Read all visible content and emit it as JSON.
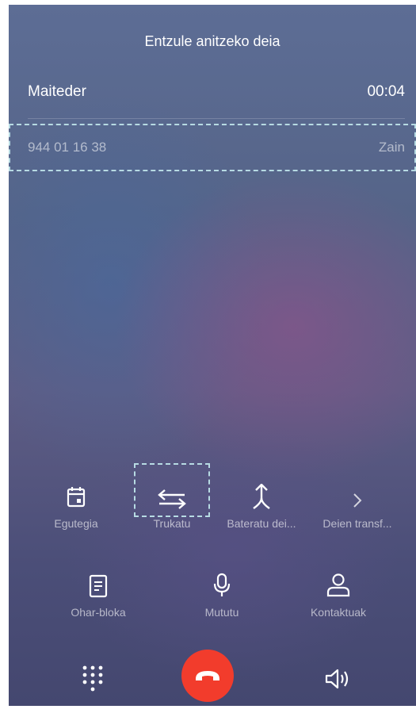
{
  "call": {
    "title": "Entzule anitzeko deia",
    "active": {
      "name": "Maiteder",
      "duration": "00:04"
    },
    "held": {
      "number": "944 01 16 38",
      "status": "Zain"
    }
  },
  "actions": {
    "row1": [
      {
        "label": "Egutegia",
        "icon": "calendar-icon"
      },
      {
        "label": "Trukatu",
        "icon": "swap-icon"
      },
      {
        "label": "Bateratu dei...",
        "icon": "merge-icon"
      },
      {
        "label": "Deien transf...",
        "icon": "chevron-right-icon"
      }
    ],
    "row2": [
      {
        "label": "Ohar-bloka",
        "icon": "notepad-icon"
      },
      {
        "label": "Mututu",
        "icon": "microphone-icon"
      },
      {
        "label": "Kontaktuak",
        "icon": "contact-icon"
      }
    ]
  },
  "bottom": {
    "dialpad_icon": "dialpad-icon",
    "end_icon": "end-call-icon",
    "speaker_icon": "speaker-icon"
  },
  "colors": {
    "end_call": "#f23c2c",
    "highlight_dash": "#b7dbe3"
  }
}
